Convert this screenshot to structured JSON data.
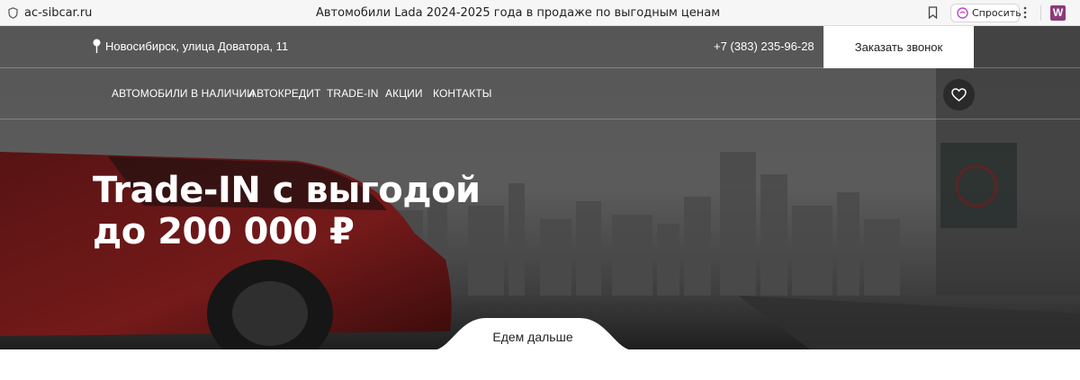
{
  "browser": {
    "url": "ac-sibcar.ru",
    "title": "Автомобили Lada 2024-2025 года в продаже по выгодным ценам",
    "ask_label": "Спросить",
    "extension_letter": "W",
    "extension_color": "#8b3a7a"
  },
  "header": {
    "address": "Новосибирск, улица Доватора, 11",
    "phone": "+7 (383) 235-96-28",
    "callback_label": "Заказать звонок"
  },
  "nav": {
    "items": [
      {
        "label": "АВТОМОБИЛИ В НАЛИЧИИ"
      },
      {
        "label": "АВТОКРЕДИТ"
      },
      {
        "label": "TRADE-IN"
      },
      {
        "label": "АКЦИИ"
      },
      {
        "label": "КОНТАКТЫ"
      }
    ],
    "favorites_icon": "heart-icon"
  },
  "hero": {
    "headline_line1": "Trade-IN с выгодой",
    "headline_line2": "до 200 000 ₽",
    "next_label": "Едем дальше"
  },
  "colors": {
    "hero_overlay": "#5e5e5e",
    "car_accent": "#8a1c1c",
    "button_bg": "#ffffff",
    "fav_button_bg": "#2a2a2a"
  }
}
